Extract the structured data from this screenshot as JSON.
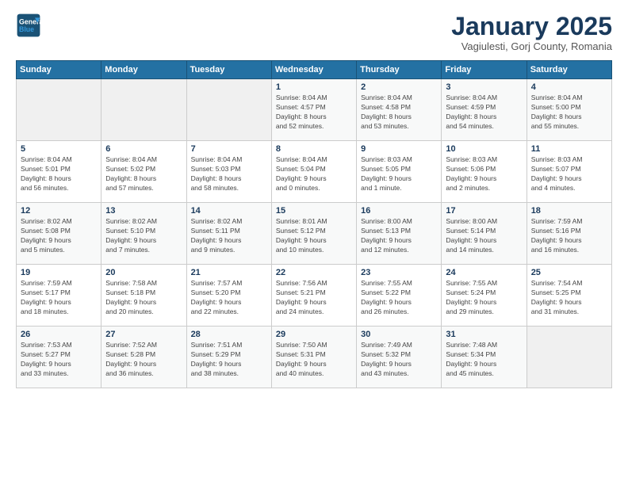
{
  "logo": {
    "line1": "General",
    "line2": "Blue"
  },
  "title": "January 2025",
  "subtitle": "Vagiulesti, Gorj County, Romania",
  "headers": [
    "Sunday",
    "Monday",
    "Tuesday",
    "Wednesday",
    "Thursday",
    "Friday",
    "Saturday"
  ],
  "weeks": [
    [
      {
        "day": "",
        "info": ""
      },
      {
        "day": "",
        "info": ""
      },
      {
        "day": "",
        "info": ""
      },
      {
        "day": "1",
        "info": "Sunrise: 8:04 AM\nSunset: 4:57 PM\nDaylight: 8 hours\nand 52 minutes."
      },
      {
        "day": "2",
        "info": "Sunrise: 8:04 AM\nSunset: 4:58 PM\nDaylight: 8 hours\nand 53 minutes."
      },
      {
        "day": "3",
        "info": "Sunrise: 8:04 AM\nSunset: 4:59 PM\nDaylight: 8 hours\nand 54 minutes."
      },
      {
        "day": "4",
        "info": "Sunrise: 8:04 AM\nSunset: 5:00 PM\nDaylight: 8 hours\nand 55 minutes."
      }
    ],
    [
      {
        "day": "5",
        "info": "Sunrise: 8:04 AM\nSunset: 5:01 PM\nDaylight: 8 hours\nand 56 minutes."
      },
      {
        "day": "6",
        "info": "Sunrise: 8:04 AM\nSunset: 5:02 PM\nDaylight: 8 hours\nand 57 minutes."
      },
      {
        "day": "7",
        "info": "Sunrise: 8:04 AM\nSunset: 5:03 PM\nDaylight: 8 hours\nand 58 minutes."
      },
      {
        "day": "8",
        "info": "Sunrise: 8:04 AM\nSunset: 5:04 PM\nDaylight: 9 hours\nand 0 minutes."
      },
      {
        "day": "9",
        "info": "Sunrise: 8:03 AM\nSunset: 5:05 PM\nDaylight: 9 hours\nand 1 minute."
      },
      {
        "day": "10",
        "info": "Sunrise: 8:03 AM\nSunset: 5:06 PM\nDaylight: 9 hours\nand 2 minutes."
      },
      {
        "day": "11",
        "info": "Sunrise: 8:03 AM\nSunset: 5:07 PM\nDaylight: 9 hours\nand 4 minutes."
      }
    ],
    [
      {
        "day": "12",
        "info": "Sunrise: 8:02 AM\nSunset: 5:08 PM\nDaylight: 9 hours\nand 5 minutes."
      },
      {
        "day": "13",
        "info": "Sunrise: 8:02 AM\nSunset: 5:10 PM\nDaylight: 9 hours\nand 7 minutes."
      },
      {
        "day": "14",
        "info": "Sunrise: 8:02 AM\nSunset: 5:11 PM\nDaylight: 9 hours\nand 9 minutes."
      },
      {
        "day": "15",
        "info": "Sunrise: 8:01 AM\nSunset: 5:12 PM\nDaylight: 9 hours\nand 10 minutes."
      },
      {
        "day": "16",
        "info": "Sunrise: 8:00 AM\nSunset: 5:13 PM\nDaylight: 9 hours\nand 12 minutes."
      },
      {
        "day": "17",
        "info": "Sunrise: 8:00 AM\nSunset: 5:14 PM\nDaylight: 9 hours\nand 14 minutes."
      },
      {
        "day": "18",
        "info": "Sunrise: 7:59 AM\nSunset: 5:16 PM\nDaylight: 9 hours\nand 16 minutes."
      }
    ],
    [
      {
        "day": "19",
        "info": "Sunrise: 7:59 AM\nSunset: 5:17 PM\nDaylight: 9 hours\nand 18 minutes."
      },
      {
        "day": "20",
        "info": "Sunrise: 7:58 AM\nSunset: 5:18 PM\nDaylight: 9 hours\nand 20 minutes."
      },
      {
        "day": "21",
        "info": "Sunrise: 7:57 AM\nSunset: 5:20 PM\nDaylight: 9 hours\nand 22 minutes."
      },
      {
        "day": "22",
        "info": "Sunrise: 7:56 AM\nSunset: 5:21 PM\nDaylight: 9 hours\nand 24 minutes."
      },
      {
        "day": "23",
        "info": "Sunrise: 7:55 AM\nSunset: 5:22 PM\nDaylight: 9 hours\nand 26 minutes."
      },
      {
        "day": "24",
        "info": "Sunrise: 7:55 AM\nSunset: 5:24 PM\nDaylight: 9 hours\nand 29 minutes."
      },
      {
        "day": "25",
        "info": "Sunrise: 7:54 AM\nSunset: 5:25 PM\nDaylight: 9 hours\nand 31 minutes."
      }
    ],
    [
      {
        "day": "26",
        "info": "Sunrise: 7:53 AM\nSunset: 5:27 PM\nDaylight: 9 hours\nand 33 minutes."
      },
      {
        "day": "27",
        "info": "Sunrise: 7:52 AM\nSunset: 5:28 PM\nDaylight: 9 hours\nand 36 minutes."
      },
      {
        "day": "28",
        "info": "Sunrise: 7:51 AM\nSunset: 5:29 PM\nDaylight: 9 hours\nand 38 minutes."
      },
      {
        "day": "29",
        "info": "Sunrise: 7:50 AM\nSunset: 5:31 PM\nDaylight: 9 hours\nand 40 minutes."
      },
      {
        "day": "30",
        "info": "Sunrise: 7:49 AM\nSunset: 5:32 PM\nDaylight: 9 hours\nand 43 minutes."
      },
      {
        "day": "31",
        "info": "Sunrise: 7:48 AM\nSunset: 5:34 PM\nDaylight: 9 hours\nand 45 minutes."
      },
      {
        "day": "",
        "info": ""
      }
    ]
  ]
}
